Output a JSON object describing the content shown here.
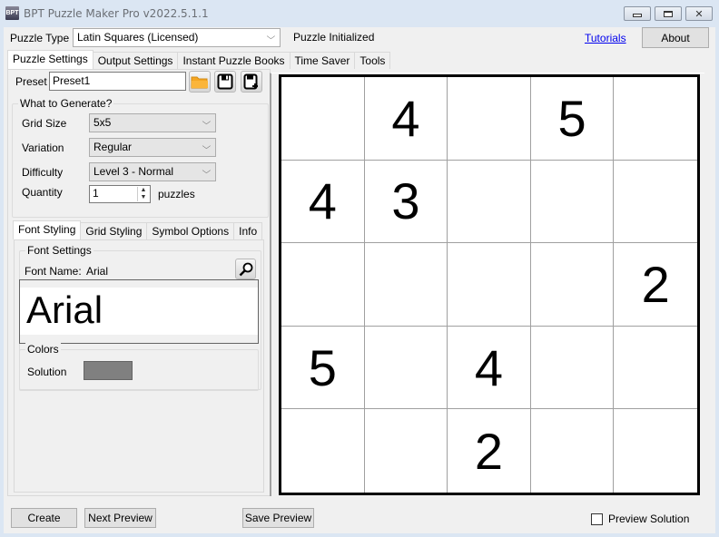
{
  "window": {
    "title": "BPT Puzzle Maker Pro v2022.5.1.1",
    "icon": "bpt-app-icon",
    "controls": [
      "minimize-icon",
      "maximize-icon",
      "close-icon"
    ]
  },
  "header": {
    "puzzle_type_label": "Puzzle Type",
    "puzzle_type_value": "Latin Squares (Licensed)",
    "status": "Puzzle Initialized",
    "tutorials_link": "Tutorials",
    "about_button": "About"
  },
  "main_tabs": [
    {
      "label": "Puzzle Settings",
      "active": true
    },
    {
      "label": "Output Settings",
      "active": false
    },
    {
      "label": "Instant Puzzle Books",
      "active": false
    },
    {
      "label": "Time Saver",
      "active": false
    },
    {
      "label": "Tools",
      "active": false
    }
  ],
  "preset": {
    "label": "Preset",
    "value": "Preset1",
    "icons": [
      "open-folder-icon",
      "save-icon",
      "save-as-icon"
    ]
  },
  "generate": {
    "title": "What to Generate?",
    "grid_size_label": "Grid Size",
    "grid_size_value": "5x5",
    "variation_label": "Variation",
    "variation_value": "Regular",
    "difficulty_label": "Difficulty",
    "difficulty_value": "Level 3 - Normal",
    "quantity_label": "Quantity",
    "quantity_value": "1",
    "quantity_unit": "puzzles"
  },
  "sub_tabs": [
    {
      "label": "Font Styling",
      "active": true
    },
    {
      "label": "Grid Styling",
      "active": false
    },
    {
      "label": "Symbol Options",
      "active": false
    },
    {
      "label": "Info",
      "active": false
    }
  ],
  "font_settings": {
    "title": "Font Settings",
    "font_name_label": "Font Name:",
    "font_name_value": "Arial",
    "preview_text": "Arial",
    "browse_icon": "magnifier-icon"
  },
  "colors": {
    "title": "Colors",
    "solution_label": "Solution",
    "solution_color": "#808080"
  },
  "puzzle_grid": {
    "size": 5,
    "cells": [
      [
        "",
        "4",
        "",
        "5",
        ""
      ],
      [
        "4",
        "3",
        "",
        "",
        ""
      ],
      [
        "",
        "",
        "",
        "",
        "2"
      ],
      [
        "5",
        "",
        "4",
        "",
        ""
      ],
      [
        "",
        "",
        "2",
        "",
        ""
      ]
    ]
  },
  "footer": {
    "create_button": "Create",
    "next_preview_button": "Next Preview",
    "save_preview_button": "Save Preview",
    "preview_solution_label": "Preview Solution",
    "preview_solution_checked": false
  }
}
